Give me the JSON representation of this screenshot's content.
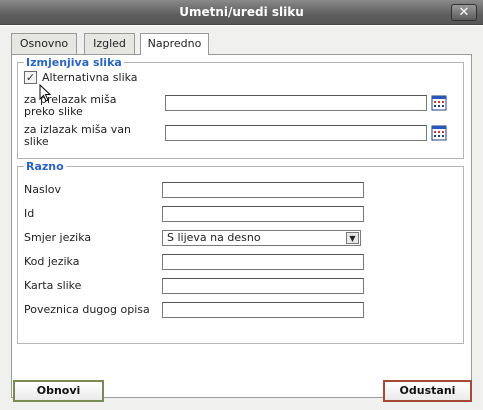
{
  "window": {
    "title": "Umetni/uredi sliku",
    "close_label": "✕"
  },
  "tabs": [
    {
      "label": "Osnovno",
      "active": false
    },
    {
      "label": "Izgled",
      "active": false
    },
    {
      "label": "Napredno",
      "active": true
    }
  ],
  "swap_image": {
    "legend": "Izmjenjiva slika",
    "checkbox_label": "Alternativna slika",
    "checkbox_checked": true,
    "mouse_over": {
      "label_line1": "za prelazak miša",
      "label_line2": "preko slike",
      "value": ""
    },
    "mouse_out": {
      "label_line1": "za izlazak miša van",
      "label_line2": "slike",
      "value": ""
    }
  },
  "misc": {
    "legend": "Razno",
    "fields": [
      {
        "label": "Naslov",
        "value": ""
      },
      {
        "label": "Id",
        "value": ""
      },
      {
        "label": "Smjer jezika",
        "value": "S lijeva na desno"
      },
      {
        "label": "Kod jezika",
        "value": ""
      },
      {
        "label": "Karta slike",
        "value": ""
      },
      {
        "label": "Poveznica dugog opisa",
        "value": ""
      }
    ]
  },
  "buttons": {
    "update": "Obnovi",
    "cancel": "Odustani"
  },
  "icons": {
    "close": "close-icon",
    "picker": "file-browser-icon",
    "dropdown": "chevron-down-icon",
    "cursor": "mouse-pointer-icon",
    "check": "checkmark-icon"
  },
  "colors": {
    "legend": "#2b64c1",
    "update_border": "#7b8a52",
    "cancel_border": "#a44a35"
  }
}
